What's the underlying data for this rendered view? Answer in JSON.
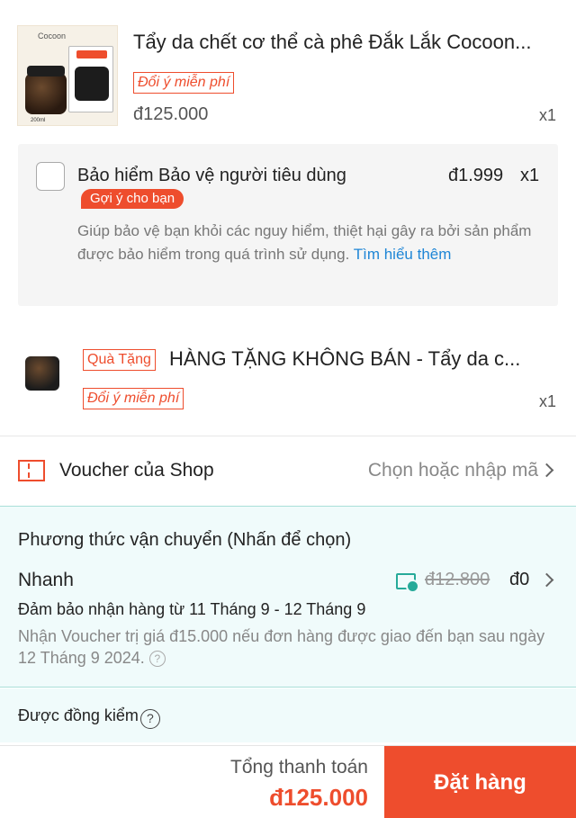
{
  "product": {
    "title": "Tẩy da chết cơ thể cà phê Đắk Lắk Cocoon...",
    "return_tag": "Đổi ý miễn phí",
    "price": "đ125.000",
    "quantity": "x1",
    "thumb_brand": "Cocoon",
    "thumb_volume": "200ml"
  },
  "insurance": {
    "title": "Bảo hiểm Bảo vệ người tiêu dùng",
    "suggest_badge": "Gợi ý cho bạn",
    "price": "đ1.999",
    "quantity": "x1",
    "description": "Giúp bảo vệ bạn khỏi các nguy hiểm, thiệt hại gây ra bởi sản phẩm được bảo hiểm trong quá trình sử dụng.",
    "learn_more": "Tìm hiểu thêm"
  },
  "gift": {
    "badge": "Quà Tặng",
    "title": "HÀNG TẶNG KHÔNG BÁN - Tẩy da c...",
    "return_tag": "Đổi ý miễn phí",
    "quantity": "x1"
  },
  "voucher": {
    "label": "Voucher của Shop",
    "action": "Chọn hoặc nhập mã"
  },
  "shipping": {
    "heading": "Phương thức vận chuyển (Nhấn để chọn)",
    "method": "Nhanh",
    "old_fee": "đ12.800",
    "new_fee": "đ0",
    "eta": "Đảm bảo nhận hàng từ 11 Tháng 9 - 12 Tháng 9",
    "note": "Nhận Voucher trị giá đ15.000 nếu đơn hàng được giao đến bạn sau ngày 12 Tháng 9 2024."
  },
  "inspection": {
    "label": "Được đồng kiểm"
  },
  "footer": {
    "total_label": "Tổng thanh toán",
    "total_value": "đ125.000",
    "order_button": "Đặt hàng"
  },
  "colors": {
    "accent": "#ee4d2d",
    "link": "#1f86d6",
    "shipping_bg": "#f0fbfb",
    "teal": "#26aa99"
  }
}
